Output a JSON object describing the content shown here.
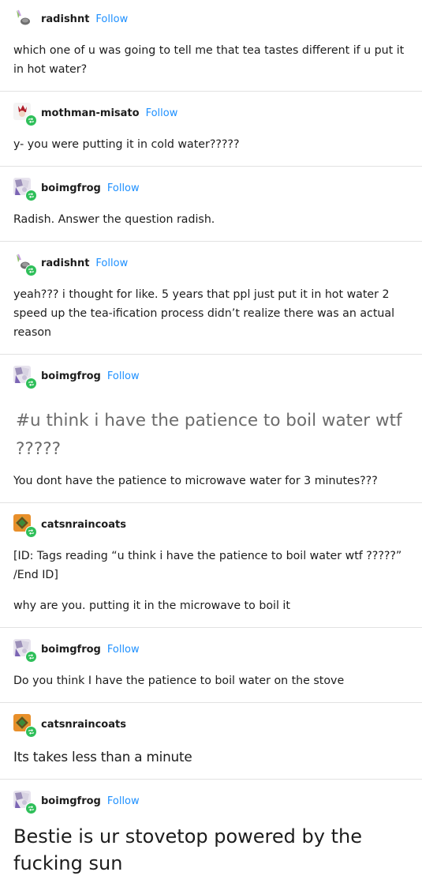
{
  "follow_label": "Follow",
  "colors": {
    "accent_blue": "#1e90ff",
    "reblog_green": "#2fbf5a",
    "divider": "#e2e2e2"
  },
  "posts": [
    {
      "username": "radishnt",
      "show_follow": true,
      "avatar": "radish-avatar",
      "text": "which one of u was going to tell me that tea tastes different if u put it in hot water?"
    },
    {
      "username": "mothman-misato",
      "show_follow": true,
      "avatar": "misato-avatar",
      "text": "y- you were putting it in cold water?????"
    },
    {
      "username": "boimgfrog",
      "show_follow": true,
      "avatar": "frog-avatar",
      "text": "Radish. Answer the question radish."
    },
    {
      "username": "radishnt",
      "show_follow": true,
      "avatar": "radish-avatar",
      "text": "yeah??? i thought for like. 5 years that ppl just put it in hot water 2 speed up the tea-ification process didn’t realize there was an actual reason"
    },
    {
      "username": "boimgfrog",
      "show_follow": true,
      "avatar": "frog-avatar",
      "tags": "#u think i have the patience to boil water wtf ?????",
      "text": "You dont have the patience to microwave water for 3 minutes???"
    },
    {
      "username": "catsnraincoats",
      "show_follow": false,
      "avatar": "cats-avatar",
      "id_text": "[ID: Tags reading “u think i have the patience to boil water wtf ?????” /End ID]",
      "text": "why are you. putting it in the microwave to boil it"
    },
    {
      "username": "boimgfrog",
      "show_follow": true,
      "avatar": "frog-avatar",
      "text": "Do you think I have the patience to boil water on the stove"
    },
    {
      "username": "catsnraincoats",
      "show_follow": false,
      "avatar": "cats-avatar",
      "text": "Its takes less than a minute"
    },
    {
      "username": "boimgfrog",
      "show_follow": true,
      "avatar": "frog-avatar",
      "text": "Bestie is ur stovetop powered by the fucking sun"
    }
  ]
}
